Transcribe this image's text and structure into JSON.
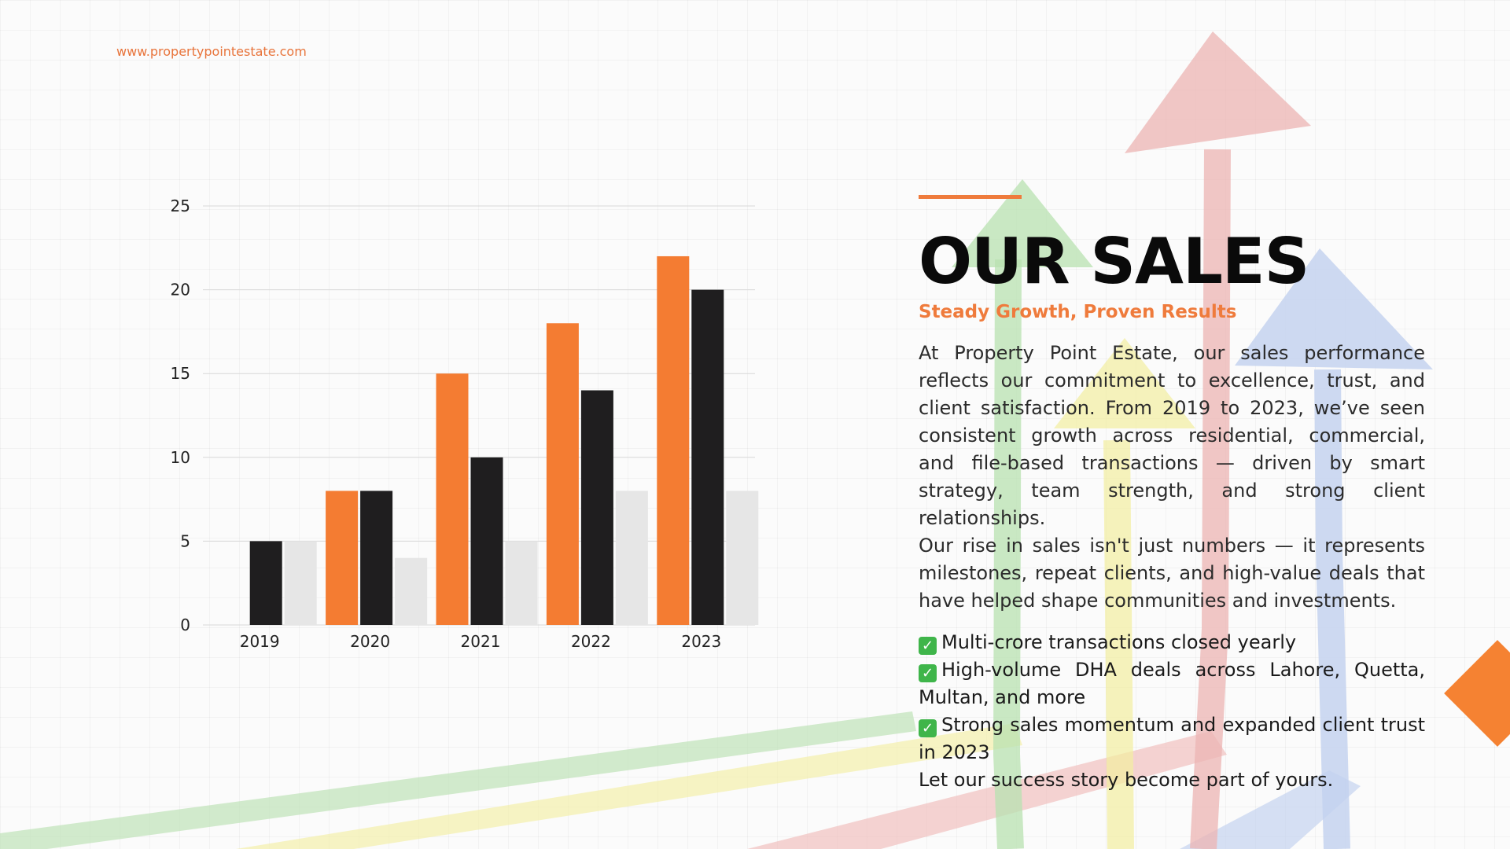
{
  "site_url": "www.propertypointestate.com",
  "colors": {
    "accent": "#ef7b3c",
    "series_orange": "#f47c32",
    "series_black": "#1f1e1f",
    "series_light": "#e6e6e6",
    "check": "#3fb54a"
  },
  "heading": {
    "title": "OUR SALES",
    "subtitle": "Steady Growth, Proven Results"
  },
  "body": {
    "paragraph_1": "At Property Point Estate, our sales performance reflects our commitment to excellence, trust, and client satisfaction. From 2019 to 2023, we’ve seen consistent growth across residential, commercial, and file-based transactions — driven by smart strategy, team strength, and strong client relationships.",
    "paragraph_2": "Our rise in sales isn't just numbers — it represents milestones, repeat clients, and high-value deals that have helped shape communities and investments."
  },
  "bullets": {
    "check_icon": "check-icon",
    "check_glyph": "✓",
    "items": [
      "Multi-crore transactions closed yearly",
      "High-volume DHA deals across Lahore, Quetta, Multan, and more",
      "Strong sales momentum and expanded client trust in 2023"
    ],
    "closing": "Let our success story become part of yours."
  },
  "chart_data": {
    "type": "bar",
    "categories": [
      "2019",
      "2020",
      "2021",
      "2022",
      "2023"
    ],
    "series": [
      {
        "values": [
          0,
          8,
          15,
          18,
          22
        ]
      },
      {
        "values": [
          5,
          8,
          10,
          14,
          20
        ]
      },
      {
        "values": [
          5,
          4,
          5,
          8,
          8
        ]
      }
    ],
    "ylim": [
      0,
      25
    ],
    "yticks": [
      "0",
      "5",
      "10",
      "15",
      "20",
      "25"
    ],
    "grid": true,
    "legend": "none"
  }
}
